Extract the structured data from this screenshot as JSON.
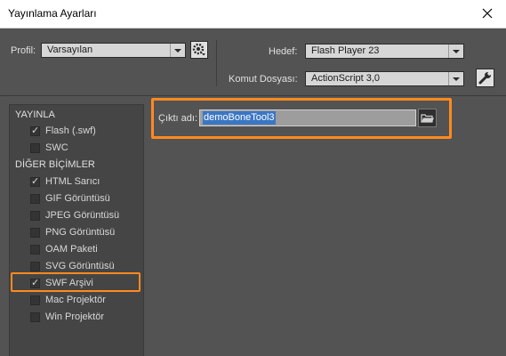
{
  "window": {
    "title": "Yayınlama Ayarları"
  },
  "profile": {
    "label": "Profil:",
    "value": "Varsayılan"
  },
  "target": {
    "label": "Hedef:",
    "value": "Flash Player 23"
  },
  "script": {
    "label": "Komut Dosyası:",
    "value": "ActionScript 3,0"
  },
  "sections": {
    "publish": "YAYINLA",
    "other": "DİĞER BİÇİMLER"
  },
  "items": [
    {
      "label": "Flash (.swf)",
      "checked": true
    },
    {
      "label": "SWC",
      "checked": false
    },
    {
      "label": "HTML Sarıcı",
      "checked": true
    },
    {
      "label": "GIF Görüntüsü",
      "checked": false
    },
    {
      "label": "JPEG Görüntüsü",
      "checked": false
    },
    {
      "label": "PNG Görüntüsü",
      "checked": false
    },
    {
      "label": "OAM Paketi",
      "checked": false
    },
    {
      "label": "SVG Görüntüsü",
      "checked": false
    },
    {
      "label": "SWF Arşivi",
      "checked": true
    },
    {
      "label": "Mac Projektör",
      "checked": false
    },
    {
      "label": "Win Projektör",
      "checked": false
    }
  ],
  "output": {
    "label": "Çıktı adı:",
    "value": "demoBoneTool3"
  },
  "colors": {
    "highlight": "#ff8a1f",
    "selection": "#3b76c3",
    "background": "#535353"
  }
}
